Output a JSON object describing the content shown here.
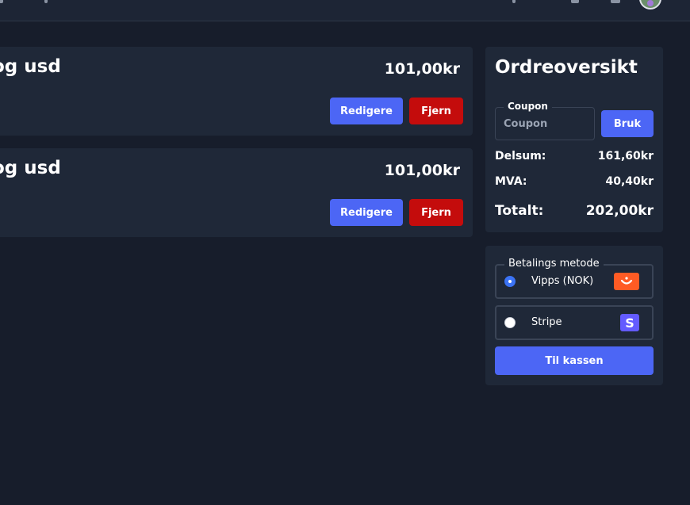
{
  "cart": {
    "items": [
      {
        "title": "og usd",
        "price": "101,00kr",
        "edit_label": "Redigere",
        "remove_label": "Fjern"
      },
      {
        "title": "og usd",
        "price": "101,00kr",
        "edit_label": "Redigere",
        "remove_label": "Fjern"
      }
    ]
  },
  "summary": {
    "title": "Ordreoversikt",
    "coupon": {
      "legend": "Coupon",
      "placeholder": "Coupon",
      "value": "",
      "apply_label": "Bruk"
    },
    "subtotal": {
      "label": "Delsum:",
      "value": "161,60kr"
    },
    "vat": {
      "label": "MVA:",
      "value": "40,40kr"
    },
    "total": {
      "label": "Totalt:",
      "value": "202,00kr"
    }
  },
  "payment": {
    "legend": "Betalings metode",
    "options": [
      {
        "label": "Vipps (NOK)",
        "selected": true,
        "icon": "vipps-logo"
      },
      {
        "label": "Stripe",
        "selected": false,
        "icon": "stripe-logo"
      }
    ],
    "checkout_label": "Til kassen"
  },
  "colors": {
    "background": "#171d2b",
    "card": "#1f2838",
    "primary": "#4c66f5",
    "danger": "#c40c0c",
    "vipps": "#ff5b24",
    "stripe": "#635bff"
  },
  "icons": {
    "stripe_glyph": "S"
  }
}
